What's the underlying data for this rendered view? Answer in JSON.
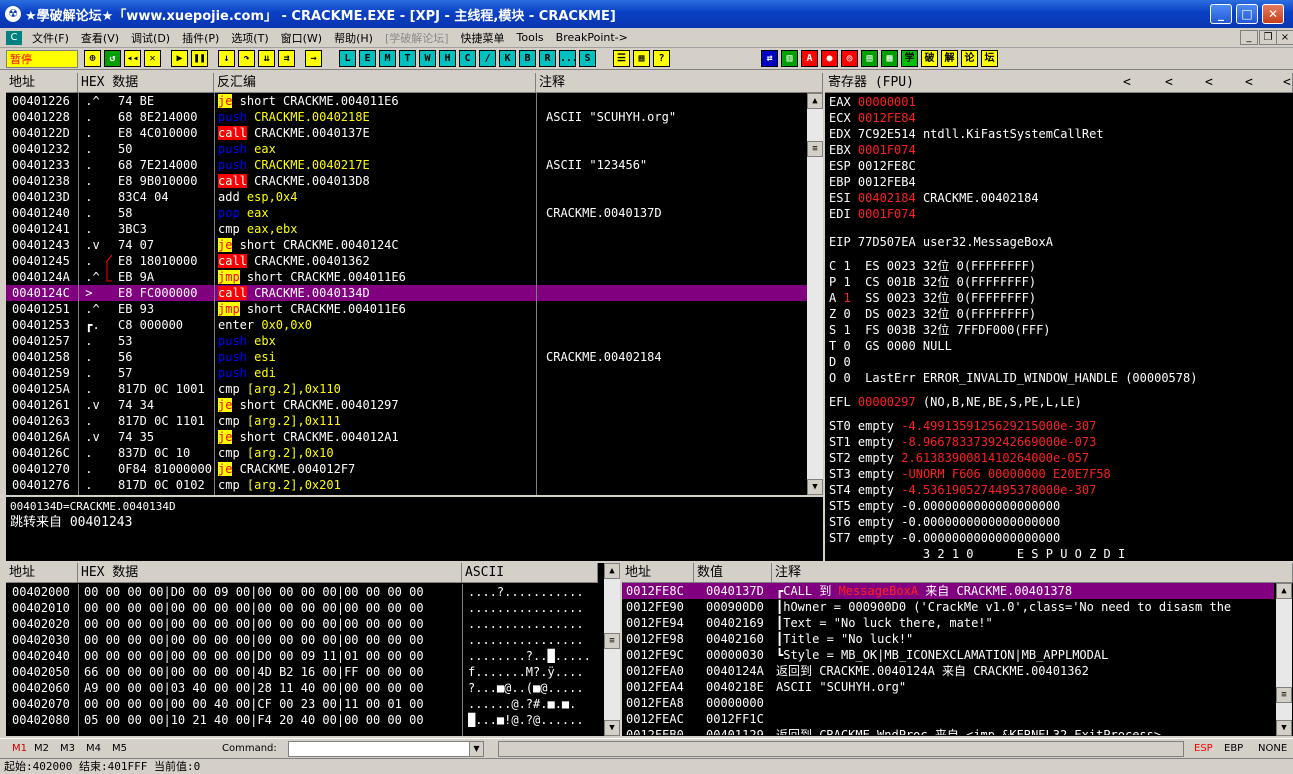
{
  "window": {
    "title": "★學破解论坛★「www.xuepojie.com」 - CRACKME.EXE - [XPJ - 主线程,模块 - CRACKME]"
  },
  "menu": [
    "文件(F)",
    "查看(V)",
    "调试(D)",
    "插件(P)",
    "选项(T)",
    "窗口(W)",
    "帮助(H)",
    "[学破解论坛]",
    "快捷菜单",
    "Tools",
    "BreakPoint->"
  ],
  "toolbar": {
    "status": "暂停",
    "letters": [
      "L",
      "E",
      "M",
      "T",
      "W",
      "H",
      "C",
      "/",
      "K",
      "B",
      "R",
      "...",
      "S"
    ],
    "brand": [
      "学",
      "破",
      "解",
      "论",
      "坛"
    ]
  },
  "cpu": {
    "headers": {
      "addr": "地址",
      "hex": "HEX 数据",
      "asm": "反汇编",
      "comment": "注释"
    },
    "rows": [
      {
        "addr": "00401226",
        "mk": " .^",
        "hex": "74 BE",
        "op": "je",
        "opk": "jmp",
        "args": " short CRACKME.004011E6",
        "cm": ""
      },
      {
        "addr": "00401228",
        "mk": " .",
        "hex": "68 8E214000",
        "op": "push",
        "opk": "push",
        "args": " CRACKME.0040218E",
        "cm": "ASCII \"SCUHYH.org\""
      },
      {
        "addr": "0040122D",
        "mk": " .",
        "hex": "E8 4C010000",
        "op": "call",
        "opk": "call",
        "args": " CRACKME.0040137E",
        "cm": ""
      },
      {
        "addr": "00401232",
        "mk": " .",
        "hex": "50",
        "op": "push",
        "opk": "push",
        "args": " eax",
        "cm": ""
      },
      {
        "addr": "00401233",
        "mk": " .",
        "hex": "68 7E214000",
        "op": "push",
        "opk": "push",
        "args": " CRACKME.0040217E",
        "cm": "ASCII \"123456\""
      },
      {
        "addr": "00401238",
        "mk": " .",
        "hex": "E8 9B010000",
        "op": "call",
        "opk": "call",
        "args": " CRACKME.004013D8",
        "cm": ""
      },
      {
        "addr": "0040123D",
        "mk": " .",
        "hex": "83C4 04",
        "op": "add",
        "opk": "plain",
        "args": " esp,0x4",
        "cm": ""
      },
      {
        "addr": "00401240",
        "mk": " .",
        "hex": "58",
        "op": "pop",
        "opk": "push",
        "args": " eax",
        "cm": "CRACKME.0040137D"
      },
      {
        "addr": "00401241",
        "mk": " .",
        "hex": "3BC3",
        "op": "cmp",
        "opk": "plain",
        "args": " eax,ebx",
        "cm": ""
      },
      {
        "addr": "00401243",
        "mk": " .v",
        "hex": "74 07",
        "op": "je",
        "opk": "jmp",
        "args": " short CRACKME.0040124C",
        "cm": ""
      },
      {
        "addr": "00401245",
        "mk": " .",
        "hex": "E8 18010000",
        "op": "call",
        "opk": "call",
        "args": " CRACKME.00401362",
        "cm": ""
      },
      {
        "addr": "0040124A",
        "mk": " .^",
        "hex": "EB 9A",
        "op": "jmp",
        "opk": "jmp",
        "args": " short CRACKME.004011E6",
        "cm": ""
      },
      {
        "addr": "0040124C",
        "mk": " >",
        "hex": "E8 FC000000",
        "op": "call",
        "opk": "call",
        "args": " CRACKME.0040134D",
        "cm": ""
      },
      {
        "addr": "00401251",
        "mk": " .^",
        "hex": "EB 93",
        "op": "jmp",
        "opk": "jmp",
        "args": " short CRACKME.004011E6",
        "cm": ""
      },
      {
        "addr": "00401253",
        "mk": " ┏.",
        "hex": "C8 000000",
        "op": "enter",
        "opk": "plain",
        "args": " 0x0,0x0",
        "cm": ""
      },
      {
        "addr": "00401257",
        "mk": " .",
        "hex": "53",
        "op": "push",
        "opk": "push",
        "args": " ebx",
        "cm": ""
      },
      {
        "addr": "00401258",
        "mk": " .",
        "hex": "56",
        "op": "push",
        "opk": "push",
        "args": " esi",
        "cm": "CRACKME.00402184"
      },
      {
        "addr": "00401259",
        "mk": " .",
        "hex": "57",
        "op": "push",
        "opk": "push",
        "args": " edi",
        "cm": ""
      },
      {
        "addr": "0040125A",
        "mk": " .",
        "hex": "817D 0C 1001",
        "op": "cmp",
        "opk": "plain",
        "args": " [arg.2],0x110",
        "cm": ""
      },
      {
        "addr": "00401261",
        "mk": " .v",
        "hex": "74 34",
        "op": "je",
        "opk": "jmp",
        "args": " short CRACKME.00401297",
        "cm": ""
      },
      {
        "addr": "00401263",
        "mk": " .",
        "hex": "817D 0C 1101",
        "op": "cmp",
        "opk": "plain",
        "args": " [arg.2],0x111",
        "cm": ""
      },
      {
        "addr": "0040126A",
        "mk": " .v",
        "hex": "74 35",
        "op": "je",
        "opk": "jmp",
        "args": " short CRACKME.004012A1",
        "cm": ""
      },
      {
        "addr": "0040126C",
        "mk": " .",
        "hex": "837D 0C 10",
        "op": "cmp",
        "opk": "plain",
        "args": " [arg.2],0x10",
        "cm": ""
      },
      {
        "addr": "00401270",
        "mk": " .",
        "hex": "0F84 81000000",
        "op": "je",
        "opk": "jmp",
        "args": " CRACKME.004012F7",
        "cm": ""
      },
      {
        "addr": "00401276",
        "mk": " .",
        "hex": "817D 0C 0102",
        "op": "cmp",
        "opk": "plain",
        "args": " [arg.2],0x201",
        "cm": ""
      }
    ],
    "info_line1": "0040134D=CRACKME.0040134D",
    "info_line2": "跳转来自 00401243"
  },
  "registers": {
    "header": "寄存器 (FPU)",
    "arrows": [
      "<",
      "<",
      "<",
      "<",
      "<"
    ],
    "gp": [
      {
        "name": "EAX",
        "val": "00000001",
        "red": true,
        "extra": ""
      },
      {
        "name": "ECX",
        "val": "0012FE84",
        "red": true,
        "extra": ""
      },
      {
        "name": "EDX",
        "val": "7C92E514",
        "red": false,
        "extra": " ntdll.KiFastSystemCallRet"
      },
      {
        "name": "EBX",
        "val": "0001F074",
        "red": true,
        "extra": ""
      },
      {
        "name": "ESP",
        "val": "0012FE8C",
        "red": false,
        "extra": ""
      },
      {
        "name": "EBP",
        "val": "0012FEB4",
        "red": false,
        "extra": ""
      },
      {
        "name": "ESI",
        "val": "00402184",
        "red": true,
        "extra": " CRACKME.00402184"
      },
      {
        "name": "EDI",
        "val": "0001F074",
        "red": true,
        "extra": ""
      }
    ],
    "eip": "EIP 77D507EA user32.MessageBoxA",
    "segs": [
      "C 1  ES 0023 32位 0(FFFFFFFF)",
      "P 1  CS 001B 32位 0(FFFFFFFF)",
      "A 1  SS 0023 32位 0(FFFFFFFF)",
      "Z 0  DS 0023 32位 0(FFFFFFFF)",
      "S 1  FS 003B 32位 7FFDF000(FFF)",
      "T 0  GS 0000 NULL",
      "D 0",
      "O 0  LastErr ERROR_INVALID_WINDOW_HANDLE (00000578)"
    ],
    "efl_val": "00000297",
    "efl_rest": " (NO,B,NE,BE,S,PE,L,LE)",
    "fpu": [
      {
        "name": "ST0 empty",
        "val": "-4.4991359125629215000e-307",
        "red": true
      },
      {
        "name": "ST1 empty",
        "val": "-8.9667833739242669000e-073",
        "red": true
      },
      {
        "name": "ST2 empty",
        "val": "2.6138390081410264000e-057",
        "red": true
      },
      {
        "name": "ST3 empty",
        "val": "-UNORM F606 00000000 E20E7F58",
        "red": true
      },
      {
        "name": "ST4 empty",
        "val": "-4.5361905274495378000e-307",
        "red": true
      },
      {
        "name": "ST5 empty",
        "val": "-0.0000000000000000000",
        "red": false
      },
      {
        "name": "ST6 empty",
        "val": "-0.0000000000000000000",
        "red": false
      },
      {
        "name": "ST7 empty",
        "val": "-0.0000000000000000000",
        "red": false
      }
    ],
    "bits": "             3 2 1 0      E S P U O Z D I"
  },
  "dump": {
    "headers": {
      "addr": "地址",
      "hex": "HEX 数据",
      "ascii": "ASCII"
    },
    "rows": [
      {
        "addr": "00402000",
        "hex": "00 00 00 00|D0 00 09 00|00 00 00 00|00 00 00 00",
        "ascii": "....?..........."
      },
      {
        "addr": "00402010",
        "hex": "00 00 00 00|00 00 00 00|00 00 00 00|00 00 00 00",
        "ascii": "................"
      },
      {
        "addr": "00402020",
        "hex": "00 00 00 00|00 00 00 00|00 00 00 00|00 00 00 00",
        "ascii": "................"
      },
      {
        "addr": "00402030",
        "hex": "00 00 00 00|00 00 00 00|00 00 00 00|00 00 00 00",
        "ascii": "................"
      },
      {
        "addr": "00402040",
        "hex": "00 00 00 00|00 00 00 00|D0 00 09 11|01 00 00 00",
        "ascii": "........?..█....."
      },
      {
        "addr": "00402050",
        "hex": "66 00 00 00|00 00 00 00|4D B2 16 00|FF 00 00 00",
        "ascii": "f.......M?.ÿ...."
      },
      {
        "addr": "00402060",
        "hex": "A9 00 00 00|03 40 00 00|28 11 40 00|00 00 00 00",
        "ascii": "?...■@..(■@....."
      },
      {
        "addr": "00402070",
        "hex": "00 00 00 00|00 00 40 00|CF 00 23 00|11 00 01 00",
        "ascii": "......@.?#.■.■."
      },
      {
        "addr": "00402080",
        "hex": "05 00 00 00|10 21 40 00|F4 20 40 00|00 00 00 00",
        "ascii": "█...■!@.?@......"
      }
    ]
  },
  "stack": {
    "headers": {
      "addr": "地址",
      "val": "数值",
      "cm": "注释"
    },
    "rows": [
      {
        "a": "0012FE8C",
        "v": "0040137D",
        "c": "┏CALL 到 ",
        "c2": "MessageBoxA",
        "c3": " 来自 CRACKME.00401378"
      },
      {
        "a": "0012FE90",
        "v": "000900D0",
        "c": "┃hOwner = 000900D0 ('CrackMe v1.0',class='No need to disasm the",
        "c2": "",
        "c3": ""
      },
      {
        "a": "0012FE94",
        "v": "00402169",
        "c": "┃Text = \"No luck there, mate!\"",
        "c2": "",
        "c3": ""
      },
      {
        "a": "0012FE98",
        "v": "00402160",
        "c": "┃Title = \"No luck!\"",
        "c2": "",
        "c3": ""
      },
      {
        "a": "0012FE9C",
        "v": "00000030",
        "c": "┗Style = MB_OK|MB_ICONEXCLAMATION|MB_APPLMODAL",
        "c2": "",
        "c3": ""
      },
      {
        "a": "0012FEA0",
        "v": "0040124A",
        "c": "返回到 CRACKME.0040124A 来自 CRACKME.00401362",
        "c2": "",
        "c3": ""
      },
      {
        "a": "0012FEA4",
        "v": "0040218E",
        "c": "ASCII \"SCUHYH.org\"",
        "c2": "",
        "c3": ""
      },
      {
        "a": "0012FEA8",
        "v": "00000000",
        "c": "",
        "c2": "",
        "c3": ""
      },
      {
        "a": "0012FEAC",
        "v": "0012FF1C",
        "c": "",
        "c2": "",
        "c3": ""
      },
      {
        "a": "0012FEB0",
        "v": "00401129",
        "c": "返回到 CRACKME.WndProc 来自 <jmp.&KERNEL32.ExitProcess>",
        "c2": "",
        "c3": ""
      }
    ]
  },
  "cmdbar": {
    "m_tabs": [
      "M1",
      "M2",
      "M3",
      "M4",
      "M5"
    ],
    "command_label": "Command:",
    "regs": [
      "ESP",
      "EBP",
      "NONE"
    ]
  },
  "status": "起始:402000 结束:401FFF 当前值:0"
}
